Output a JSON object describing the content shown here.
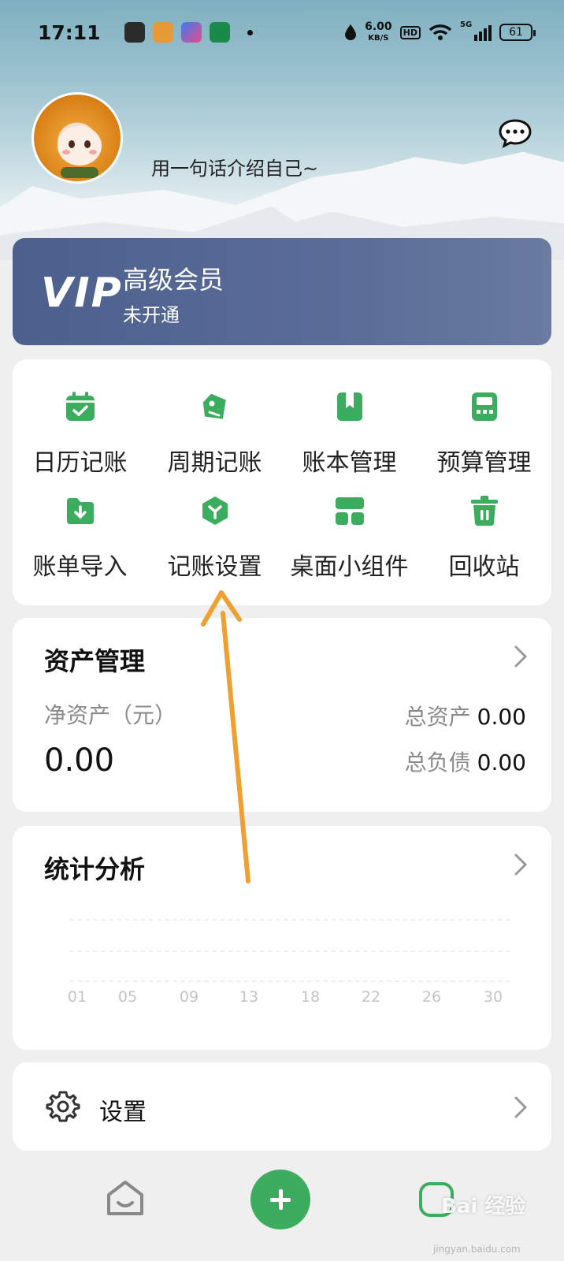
{
  "status_bar": {
    "time": "17:11",
    "speed_value": "6.00",
    "speed_unit": "KB/S",
    "hd": "HD",
    "network": "5G",
    "battery": "61"
  },
  "profile": {
    "intro": "用一句话介绍自己~"
  },
  "vip": {
    "logo": "VIP",
    "title": "高级会员",
    "status": "未开通"
  },
  "shortcuts": [
    {
      "label": "日历记账",
      "icon": "calendar-check-icon"
    },
    {
      "label": "周期记账",
      "icon": "tag-icon"
    },
    {
      "label": "账本管理",
      "icon": "bookmark-book-icon"
    },
    {
      "label": "预算管理",
      "icon": "calculator-icon"
    },
    {
      "label": "账单导入",
      "icon": "folder-download-icon"
    },
    {
      "label": "记账设置",
      "icon": "hexagon-setting-icon"
    },
    {
      "label": "桌面小组件",
      "icon": "widget-grid-icon"
    },
    {
      "label": "回收站",
      "icon": "trash-icon"
    }
  ],
  "assets": {
    "title": "资产管理",
    "net_label": "净资产（元）",
    "net_value": "0.00",
    "total_assets_label": "总资产",
    "total_assets_value": "0.00",
    "total_debt_label": "总负债",
    "total_debt_value": "0.00"
  },
  "stats": {
    "title": "统计分析"
  },
  "chart_data": {
    "type": "line",
    "categories": [
      "01",
      "05",
      "09",
      "13",
      "18",
      "22",
      "26",
      "30"
    ],
    "values": [
      0,
      0,
      0,
      0,
      0,
      0,
      0,
      0
    ],
    "grid": true
  },
  "settings": {
    "label": "设置"
  },
  "watermark": {
    "text": "Bai 经验",
    "sub": "jingyan.baidu.com"
  },
  "colors": {
    "accent_green": "#3cad5e",
    "vip_bg": "#4d5f8c",
    "annotation_arrow": "#f0a030"
  }
}
